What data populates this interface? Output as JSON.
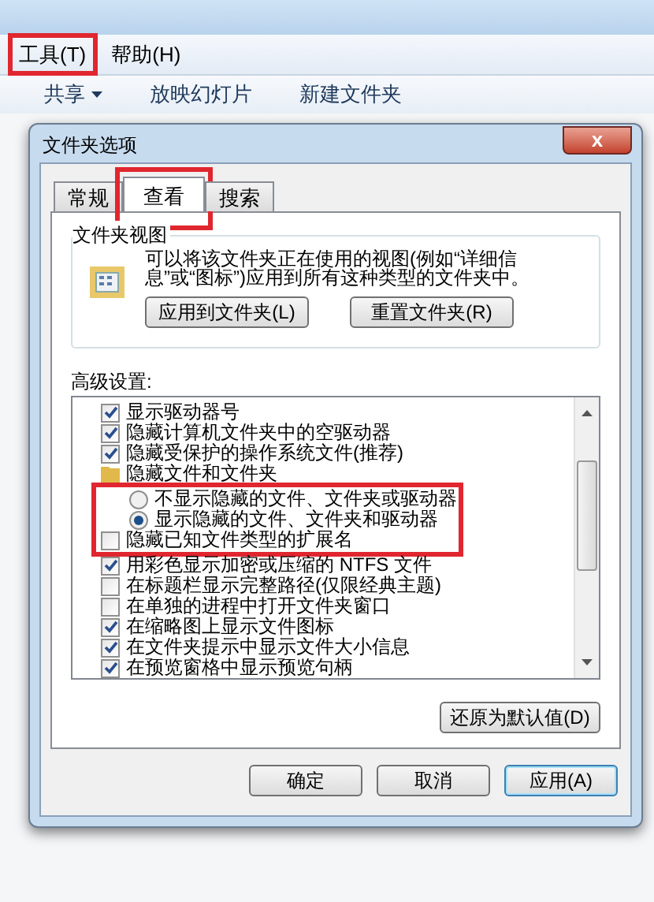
{
  "menu_bar": {
    "items": [
      {
        "label": "工具(T)",
        "highlighted": true
      },
      {
        "label": "帮助(H)",
        "highlighted": false
      }
    ]
  },
  "toolbar": {
    "items": [
      {
        "label": "共享",
        "dropdown": true
      },
      {
        "label": "放映幻灯片",
        "dropdown": false
      },
      {
        "label": "新建文件夹",
        "dropdown": false
      }
    ]
  },
  "dialog": {
    "title": "文件夹选项",
    "close": "x",
    "tabs": [
      {
        "label": "常规",
        "selected": false,
        "highlighted": false
      },
      {
        "label": "查看",
        "selected": true,
        "highlighted": true
      },
      {
        "label": "搜索",
        "selected": false,
        "highlighted": false
      }
    ],
    "folder_views": {
      "title": "文件夹视图",
      "description": "可以将该文件夹正在使用的视图(例如“详细信息”或“图标”)应用到所有这种类型的文件夹中。",
      "buttons": [
        "应用到文件夹(L)",
        "重置文件夹(R)"
      ]
    },
    "advanced": {
      "label": "高级设置:",
      "items": [
        {
          "kind": "checkbox",
          "label": "显示驱动器号",
          "checked": true,
          "highlighted": false
        },
        {
          "kind": "checkbox",
          "label": "隐藏计算机文件夹中的空驱动器",
          "checked": true,
          "highlighted": false
        },
        {
          "kind": "checkbox",
          "label": "隐藏受保护的操作系统文件(推荐)",
          "checked": true,
          "highlighted": false
        },
        {
          "kind": "folder",
          "label": "隐藏文件和文件夹",
          "highlighted": false,
          "children": [
            {
              "label": "不显示隐藏的文件、文件夹或驱动器",
              "selected": false,
              "highlighted": true
            },
            {
              "label": "显示隐藏的文件、文件夹和驱动器",
              "selected": true,
              "highlighted": true
            }
          ]
        },
        {
          "kind": "checkbox",
          "label": "隐藏已知文件类型的扩展名",
          "checked": false,
          "highlighted": true
        },
        {
          "kind": "checkbox",
          "label": "用彩色显示加密或压缩的 NTFS 文件",
          "checked": true,
          "highlighted": false
        },
        {
          "kind": "checkbox",
          "label": "在标题栏显示完整路径(仅限经典主题)",
          "checked": false,
          "highlighted": false
        },
        {
          "kind": "checkbox",
          "label": "在单独的进程中打开文件夹窗口",
          "checked": false,
          "highlighted": false
        },
        {
          "kind": "checkbox",
          "label": "在缩略图上显示文件图标",
          "checked": true,
          "highlighted": false
        },
        {
          "kind": "checkbox",
          "label": "在文件夹提示中显示文件大小信息",
          "checked": true,
          "highlighted": false
        },
        {
          "kind": "checkbox",
          "label": "在预览窗格中显示预览句柄",
          "checked": true,
          "highlighted": false
        }
      ]
    },
    "restore_button": "还原为默认值(D)",
    "buttons": [
      {
        "label": "确定",
        "default": false
      },
      {
        "label": "取消",
        "default": false
      },
      {
        "label": "应用(A)",
        "default": true
      }
    ]
  }
}
